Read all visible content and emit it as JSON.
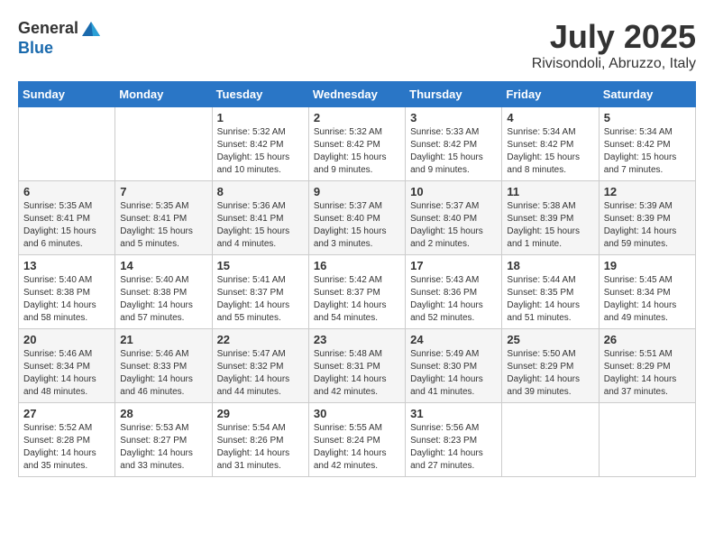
{
  "logo": {
    "general": "General",
    "blue": "Blue"
  },
  "title": "July 2025",
  "location": "Rivisondoli, Abruzzo, Italy",
  "days_of_week": [
    "Sunday",
    "Monday",
    "Tuesday",
    "Wednesday",
    "Thursday",
    "Friday",
    "Saturday"
  ],
  "weeks": [
    [
      {
        "day": "",
        "info": ""
      },
      {
        "day": "",
        "info": ""
      },
      {
        "day": "1",
        "info": "Sunrise: 5:32 AM\nSunset: 8:42 PM\nDaylight: 15 hours and 10 minutes."
      },
      {
        "day": "2",
        "info": "Sunrise: 5:32 AM\nSunset: 8:42 PM\nDaylight: 15 hours and 9 minutes."
      },
      {
        "day": "3",
        "info": "Sunrise: 5:33 AM\nSunset: 8:42 PM\nDaylight: 15 hours and 9 minutes."
      },
      {
        "day": "4",
        "info": "Sunrise: 5:34 AM\nSunset: 8:42 PM\nDaylight: 15 hours and 8 minutes."
      },
      {
        "day": "5",
        "info": "Sunrise: 5:34 AM\nSunset: 8:42 PM\nDaylight: 15 hours and 7 minutes."
      }
    ],
    [
      {
        "day": "6",
        "info": "Sunrise: 5:35 AM\nSunset: 8:41 PM\nDaylight: 15 hours and 6 minutes."
      },
      {
        "day": "7",
        "info": "Sunrise: 5:35 AM\nSunset: 8:41 PM\nDaylight: 15 hours and 5 minutes."
      },
      {
        "day": "8",
        "info": "Sunrise: 5:36 AM\nSunset: 8:41 PM\nDaylight: 15 hours and 4 minutes."
      },
      {
        "day": "9",
        "info": "Sunrise: 5:37 AM\nSunset: 8:40 PM\nDaylight: 15 hours and 3 minutes."
      },
      {
        "day": "10",
        "info": "Sunrise: 5:37 AM\nSunset: 8:40 PM\nDaylight: 15 hours and 2 minutes."
      },
      {
        "day": "11",
        "info": "Sunrise: 5:38 AM\nSunset: 8:39 PM\nDaylight: 15 hours and 1 minute."
      },
      {
        "day": "12",
        "info": "Sunrise: 5:39 AM\nSunset: 8:39 PM\nDaylight: 14 hours and 59 minutes."
      }
    ],
    [
      {
        "day": "13",
        "info": "Sunrise: 5:40 AM\nSunset: 8:38 PM\nDaylight: 14 hours and 58 minutes."
      },
      {
        "day": "14",
        "info": "Sunrise: 5:40 AM\nSunset: 8:38 PM\nDaylight: 14 hours and 57 minutes."
      },
      {
        "day": "15",
        "info": "Sunrise: 5:41 AM\nSunset: 8:37 PM\nDaylight: 14 hours and 55 minutes."
      },
      {
        "day": "16",
        "info": "Sunrise: 5:42 AM\nSunset: 8:37 PM\nDaylight: 14 hours and 54 minutes."
      },
      {
        "day": "17",
        "info": "Sunrise: 5:43 AM\nSunset: 8:36 PM\nDaylight: 14 hours and 52 minutes."
      },
      {
        "day": "18",
        "info": "Sunrise: 5:44 AM\nSunset: 8:35 PM\nDaylight: 14 hours and 51 minutes."
      },
      {
        "day": "19",
        "info": "Sunrise: 5:45 AM\nSunset: 8:34 PM\nDaylight: 14 hours and 49 minutes."
      }
    ],
    [
      {
        "day": "20",
        "info": "Sunrise: 5:46 AM\nSunset: 8:34 PM\nDaylight: 14 hours and 48 minutes."
      },
      {
        "day": "21",
        "info": "Sunrise: 5:46 AM\nSunset: 8:33 PM\nDaylight: 14 hours and 46 minutes."
      },
      {
        "day": "22",
        "info": "Sunrise: 5:47 AM\nSunset: 8:32 PM\nDaylight: 14 hours and 44 minutes."
      },
      {
        "day": "23",
        "info": "Sunrise: 5:48 AM\nSunset: 8:31 PM\nDaylight: 14 hours and 42 minutes."
      },
      {
        "day": "24",
        "info": "Sunrise: 5:49 AM\nSunset: 8:30 PM\nDaylight: 14 hours and 41 minutes."
      },
      {
        "day": "25",
        "info": "Sunrise: 5:50 AM\nSunset: 8:29 PM\nDaylight: 14 hours and 39 minutes."
      },
      {
        "day": "26",
        "info": "Sunrise: 5:51 AM\nSunset: 8:29 PM\nDaylight: 14 hours and 37 minutes."
      }
    ],
    [
      {
        "day": "27",
        "info": "Sunrise: 5:52 AM\nSunset: 8:28 PM\nDaylight: 14 hours and 35 minutes."
      },
      {
        "day": "28",
        "info": "Sunrise: 5:53 AM\nSunset: 8:27 PM\nDaylight: 14 hours and 33 minutes."
      },
      {
        "day": "29",
        "info": "Sunrise: 5:54 AM\nSunset: 8:26 PM\nDaylight: 14 hours and 31 minutes."
      },
      {
        "day": "30",
        "info": "Sunrise: 5:55 AM\nSunset: 8:24 PM\nDaylight: 14 hours and 42 minutes."
      },
      {
        "day": "31",
        "info": "Sunrise: 5:56 AM\nSunset: 8:23 PM\nDaylight: 14 hours and 27 minutes."
      },
      {
        "day": "",
        "info": ""
      },
      {
        "day": "",
        "info": ""
      }
    ]
  ]
}
